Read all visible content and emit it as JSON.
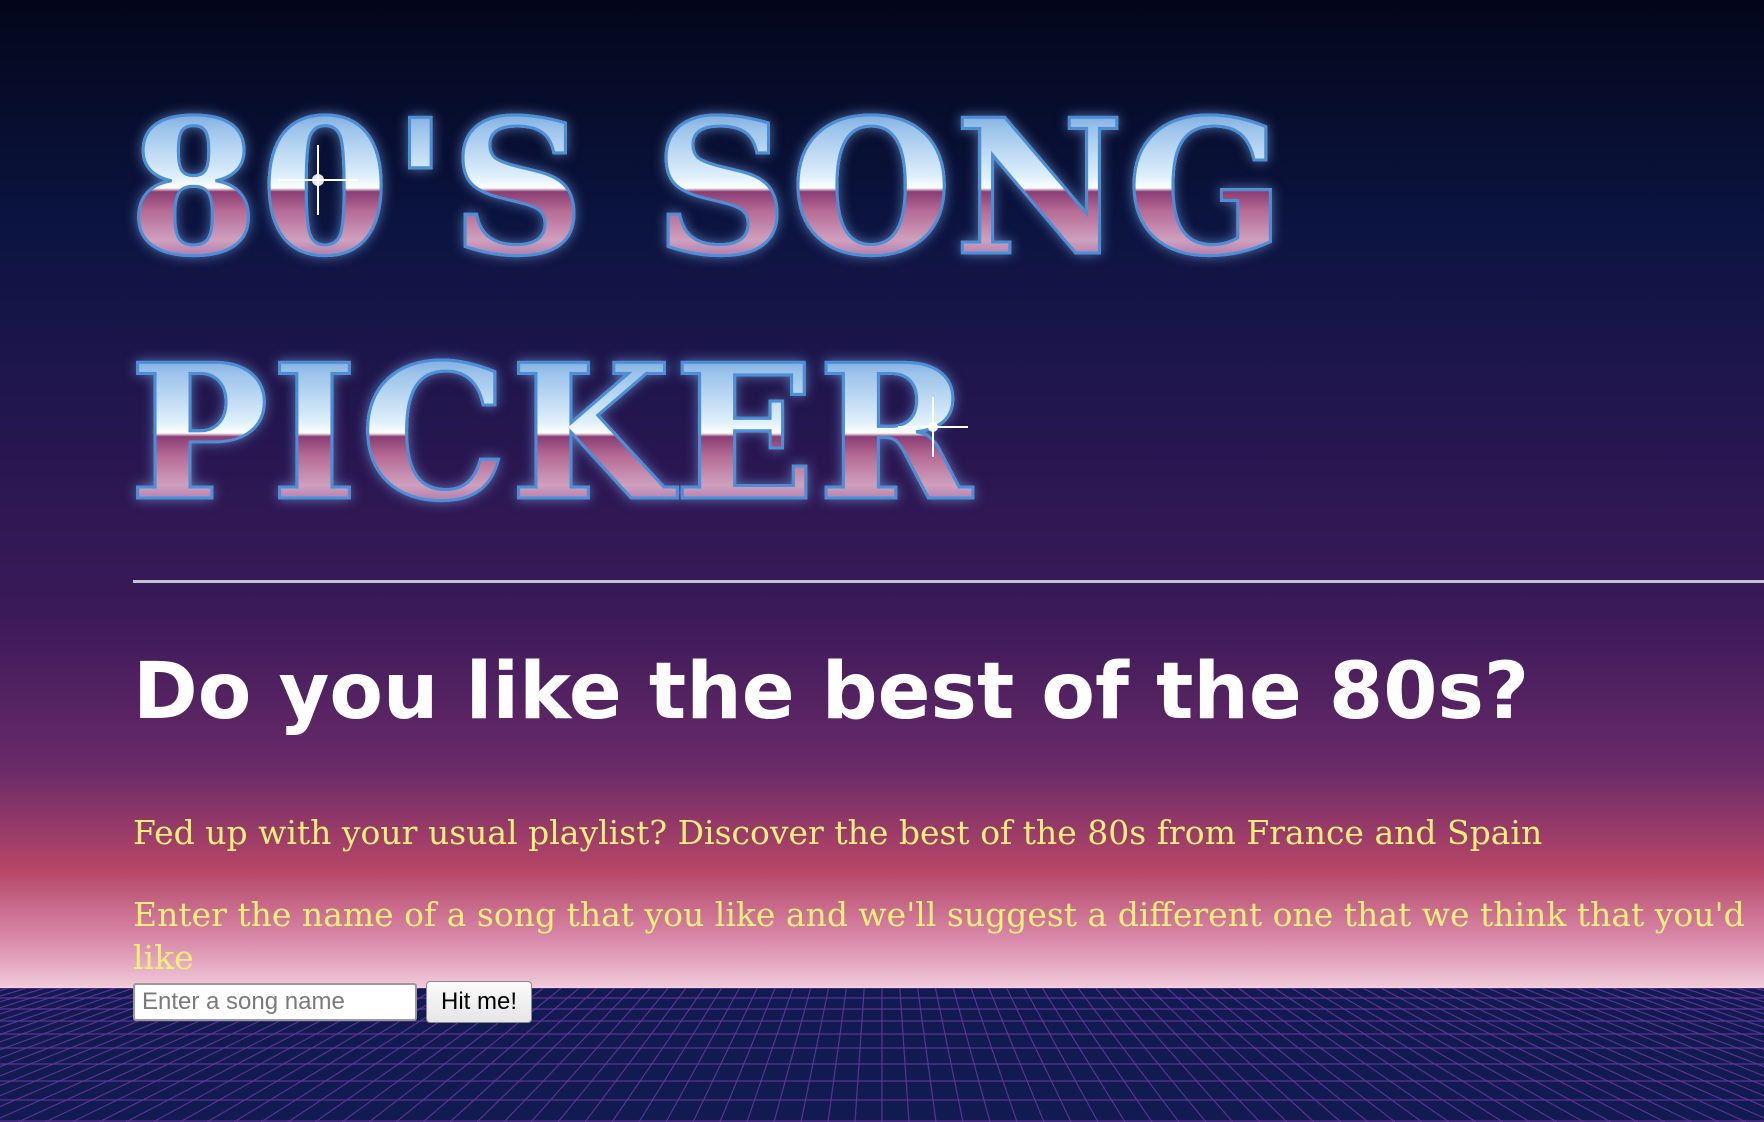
{
  "logo": {
    "line1": "80'S SONG",
    "line2": "PICKER"
  },
  "headline": "Do you like the best of the 80s?",
  "tagline": "Fed up with your usual playlist? Discover the best of the 80s from France and Spain",
  "instructions": "Enter the name of a song that you like and we'll suggest a different one that we think that you'd like",
  "form": {
    "song_input_value": "",
    "song_input_placeholder": "Enter a song name",
    "submit_label": "Hit me!"
  },
  "colors": {
    "headline": "#ffffff",
    "body_text": "#f2ee7a",
    "grid_background": "#121a52",
    "grid_lines": "#6a3aa0"
  },
  "icons": [
    "sparkle-icon"
  ]
}
